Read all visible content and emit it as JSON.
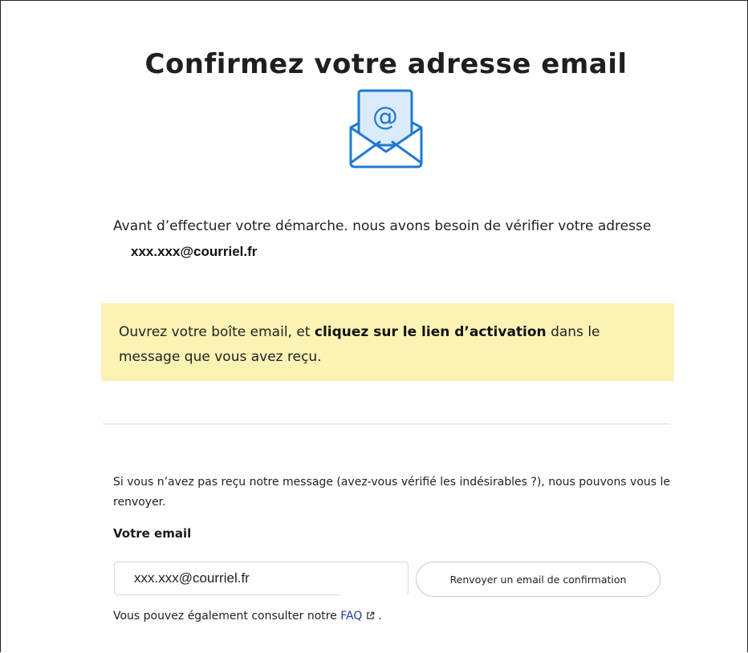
{
  "page": {
    "title": "Confirmez votre adresse email"
  },
  "icons": {
    "envelope": "envelope-at-icon",
    "external_link": "external-link-icon"
  },
  "intro": {
    "text": "Avant d’effectuer votre démarche. nous avons besoin de vérifier votre adresse",
    "email": "xxx.xxx@courriel.fr"
  },
  "notice": {
    "before": "Ouvrez votre boîte email, et ",
    "bold": "cliquez sur le lien d’activation",
    "after": " dans le message que vous avez reçu."
  },
  "resend": {
    "info": "Si vous n’avez pas reçu notre message (avez-vous vérifié les indésirables ?), nous pouvons vous le renvoyer.",
    "field_label": "Votre email",
    "email_value": "xxx.xxx@courriel.fr",
    "button_label": "Renvoyer un email de confirmation"
  },
  "faq": {
    "before": "Vous pouvez également consulter notre ",
    "link": "FAQ",
    "after": "."
  },
  "colors": {
    "notice_background": "#fbf3b4",
    "icon_blue": "#1f7bd1",
    "icon_light_blue": "#dcebfb",
    "link": "#1c3f9e"
  }
}
